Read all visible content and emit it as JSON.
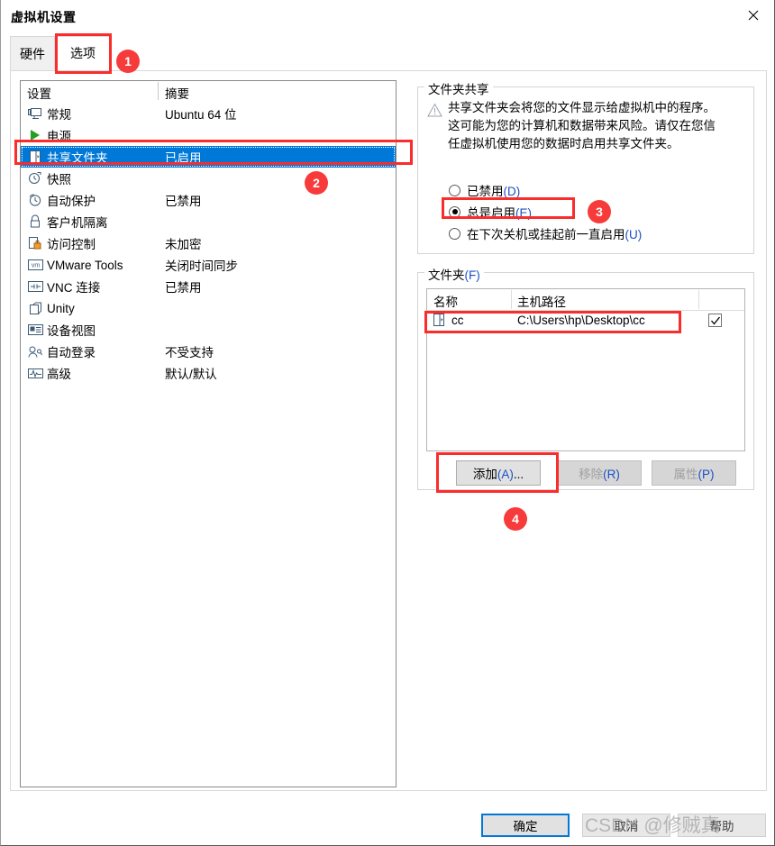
{
  "window": {
    "title": "虚拟机设置",
    "close_icon": "close-icon"
  },
  "tabs": [
    {
      "label": "硬件",
      "selected": false
    },
    {
      "label": "选项",
      "selected": true
    }
  ],
  "settings_list": {
    "headers": {
      "setting": "设置",
      "summary": "摘要"
    },
    "rows": [
      {
        "icon": "monitor-icon",
        "label": "常规",
        "summary": "Ubuntu 64 位",
        "selected": false
      },
      {
        "icon": "play-icon",
        "label": "电源",
        "summary": "",
        "selected": false
      },
      {
        "icon": "shared-folder-icon",
        "label": "共享文件夹",
        "summary": "已启用",
        "selected": true
      },
      {
        "icon": "snapshot-icon",
        "label": "快照",
        "summary": "",
        "selected": false
      },
      {
        "icon": "clock-icon",
        "label": "自动保护",
        "summary": "已禁用",
        "selected": false
      },
      {
        "icon": "lock-icon",
        "label": "客户机隔离",
        "summary": "",
        "selected": false
      },
      {
        "icon": "access-control-icon",
        "label": "访问控制",
        "summary": "未加密",
        "selected": false
      },
      {
        "icon": "vmware-tools-icon",
        "label": "VMware Tools",
        "summary": "关闭时间同步",
        "selected": false
      },
      {
        "icon": "vnc-icon",
        "label": "VNC 连接",
        "summary": "已禁用",
        "selected": false
      },
      {
        "icon": "unity-icon",
        "label": "Unity",
        "summary": "",
        "selected": false
      },
      {
        "icon": "device-view-icon",
        "label": "设备视图",
        "summary": "",
        "selected": false
      },
      {
        "icon": "auto-login-icon",
        "label": "自动登录",
        "summary": "不受支持",
        "selected": false
      },
      {
        "icon": "advanced-icon",
        "label": "高级",
        "summary": "默认/默认",
        "selected": false
      }
    ]
  },
  "folder_sharing": {
    "group_title": "文件夹共享",
    "warning_icon": "warning-icon",
    "warning_text": "共享文件夹会将您的文件显示给虚拟机中的程序。这可能为您的计算机和数据带来风险。请仅在您信任虚拟机使用您的数据时启用共享文件夹。",
    "options": [
      {
        "label": "已禁用(D)",
        "plain": "已禁用",
        "key": "(D)",
        "checked": false
      },
      {
        "label": "总是启用(E)",
        "plain": "总是启用",
        "key": "(E)",
        "checked": true
      },
      {
        "label": "在下次关机或挂起前一直启用(U)",
        "plain": "在下次关机或挂起前一直启用",
        "key": "(U)",
        "checked": false
      }
    ]
  },
  "folders": {
    "group_title": "文件夹(F)",
    "columns": [
      "名称",
      "主机路径"
    ],
    "rows": [
      {
        "icon": "shared-folder-icon",
        "name": "cc",
        "path": "C:\\Users\\hp\\Desktop\\cc",
        "enabled": true
      }
    ],
    "buttons": [
      {
        "label": "添加(A)...",
        "disabled": false
      },
      {
        "label": "移除(R)",
        "disabled": true
      },
      {
        "label": "属性(P)",
        "disabled": true
      }
    ]
  },
  "footer": {
    "ok": "确定",
    "cancel": "取消",
    "help": "帮助"
  },
  "annotations": {
    "steps": [
      "1",
      "2",
      "3",
      "4"
    ],
    "color": "#f73b3b"
  },
  "watermark": "CSDN @修贼真"
}
